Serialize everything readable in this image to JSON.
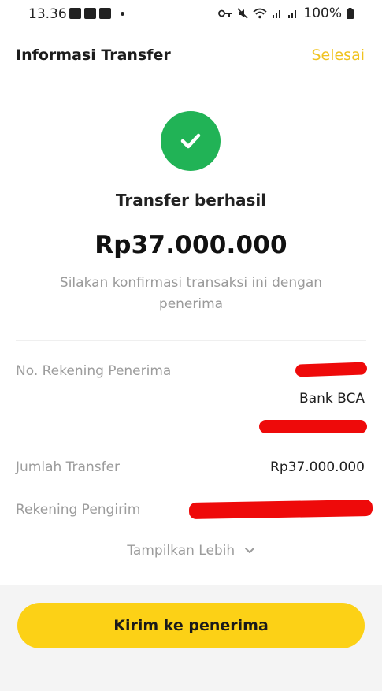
{
  "status_bar": {
    "time": "13.36",
    "battery": "100%"
  },
  "header": {
    "title": "Informasi Transfer",
    "done_label": "Selesai"
  },
  "success": {
    "title": "Transfer berhasil",
    "amount": "Rp37.000.000",
    "note": "Silakan konfirmasi transaksi ini dengan penerima"
  },
  "details": {
    "recipient_account_label": "No. Rekening Penerima",
    "recipient_bank": "Bank BCA",
    "transfer_amount_label": "Jumlah Transfer",
    "transfer_amount_value": "Rp37.000.000",
    "sender_account_label": "Rekening Pengirim"
  },
  "show_more_label": "Tampilkan Lebih",
  "send_button_label": "Kirim ke penerima",
  "colors": {
    "accent_yellow": "#fcd116",
    "done_text": "#f0c31f",
    "success_green": "#21b356",
    "redaction_red": "#ee0a0a"
  }
}
